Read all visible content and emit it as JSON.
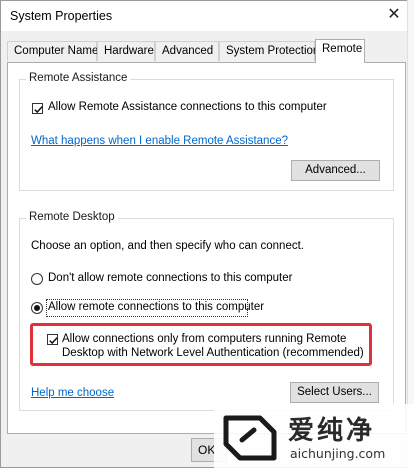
{
  "window": {
    "title": "System Properties",
    "close_glyph": "✕"
  },
  "tabs": [
    {
      "label": "Computer Name",
      "active": false
    },
    {
      "label": "Hardware",
      "active": false
    },
    {
      "label": "Advanced",
      "active": false
    },
    {
      "label": "System Protection",
      "active": false
    },
    {
      "label": "Remote",
      "active": true
    }
  ],
  "remote_assistance": {
    "group_title": "Remote Assistance",
    "allow_checkbox_label": "Allow Remote Assistance connections to this computer",
    "allow_checked": true,
    "help_link": "What happens when I enable Remote Assistance?",
    "advanced_button": "Advanced..."
  },
  "remote_desktop": {
    "group_title": "Remote Desktop",
    "instruction": "Choose an option, and then specify who can connect.",
    "option_dont_allow": "Don't allow remote connections to this computer",
    "option_allow": "Allow remote connections to this computer",
    "selected_option": "allow",
    "nla_label_line1": "Allow connections only from computers running Remote",
    "nla_label_line2": "Desktop with Network Level Authentication (recommended)",
    "nla_checked": true,
    "help_link": "Help me choose",
    "select_users_button": "Select Users..."
  },
  "footer": {
    "ok_button": "OK"
  },
  "watermark": {
    "text": "爱纯净",
    "url": "aichunjing.com"
  },
  "colors": {
    "highlight_box": "#e0303a",
    "link": "#0066cc"
  }
}
